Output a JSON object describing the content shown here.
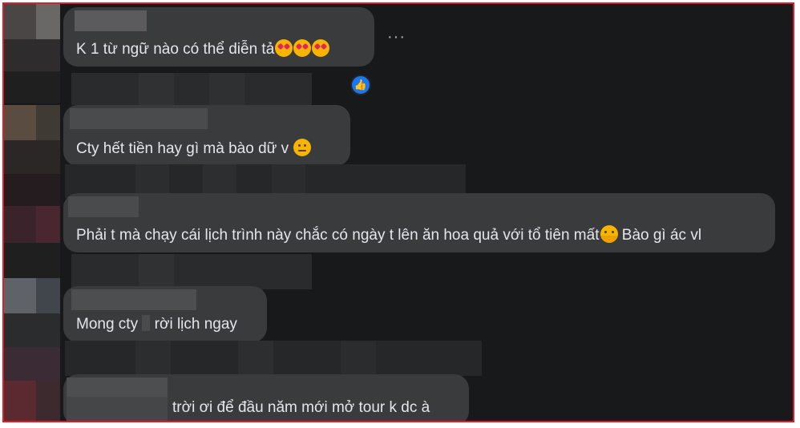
{
  "colors": {
    "frame_border": "#e11d2a",
    "background": "#18191a",
    "bubble": "#3a3b3c",
    "text": "#e4e6eb",
    "like_blue": "#1877f2"
  },
  "comments": [
    {
      "text": "K 1 từ ngữ nào có thể diễn tả",
      "emojis": [
        "smiling-face-with-hearts-icon",
        "smiling-face-with-hearts-icon",
        "smiling-face-with-hearts-icon"
      ]
    },
    {
      "text": "Cty hết tiền hay gì mà bào dữ v",
      "emojis": [
        "neutral-face-icon"
      ]
    },
    {
      "text": "Phải t mà chạy cái lịch trình này chắc có ngày t lên ăn hoa quả với tổ tiên mất",
      "text_after": " Bào gì ác vl",
      "emojis": [
        "hugging-face-icon"
      ]
    },
    {
      "text": "Mong cty",
      "text_after": "rời lịch ngay"
    },
    {
      "text": "trời ơi để đầu năm mới mở tour k dc à"
    }
  ],
  "menu": {
    "more_label": "···"
  },
  "reaction": {
    "type": "like-icon",
    "glyph": "👍"
  }
}
